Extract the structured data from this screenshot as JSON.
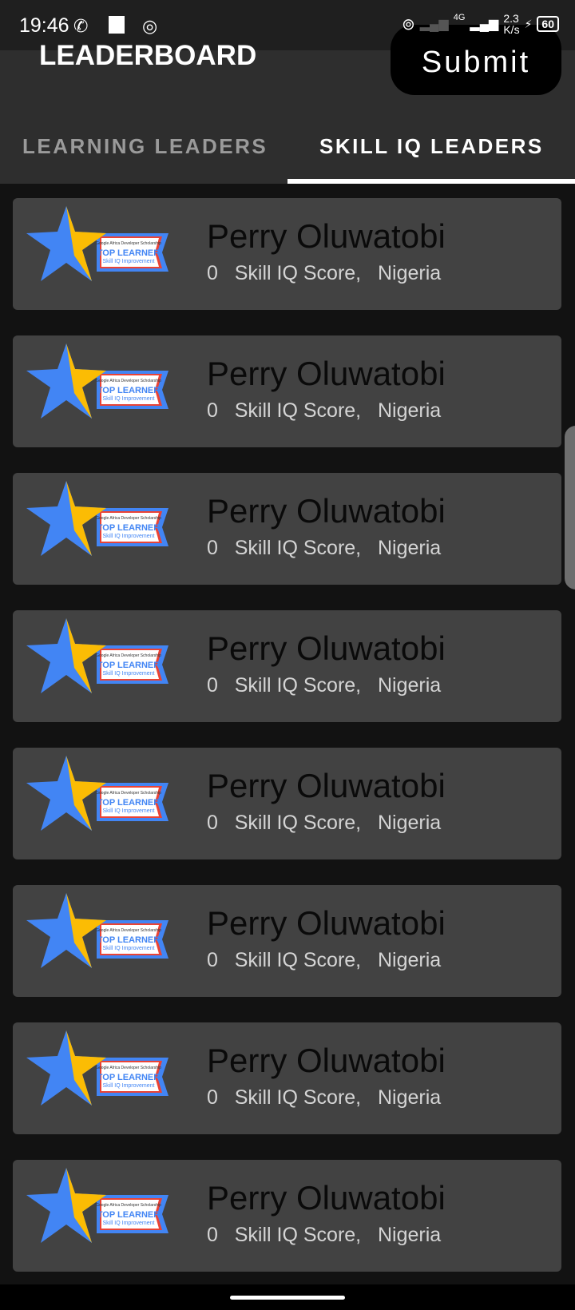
{
  "status_bar": {
    "time": "19:46",
    "network": "4G",
    "speed": "2.3",
    "speed_unit": "K/s",
    "battery": "60"
  },
  "header": {
    "title": "LEADERBOARD",
    "submit_label": "Submit"
  },
  "tabs": [
    {
      "label": "LEARNING LEADERS",
      "active": false
    },
    {
      "label": "SKILL IQ LEADERS",
      "active": true
    }
  ],
  "badge": {
    "org": "Google Africa Developer Scholarship",
    "title": "TOP LEARNER",
    "subtitle": "Skill IQ Improvement"
  },
  "leaders": [
    {
      "name": "Perry Oluwatobi",
      "score": "0",
      "score_label": "Skill IQ Score,",
      "country": "Nigeria"
    },
    {
      "name": "Perry Oluwatobi",
      "score": "0",
      "score_label": "Skill IQ Score,",
      "country": "Nigeria"
    },
    {
      "name": "Perry Oluwatobi",
      "score": "0",
      "score_label": "Skill IQ Score,",
      "country": "Nigeria"
    },
    {
      "name": "Perry Oluwatobi",
      "score": "0",
      "score_label": "Skill IQ Score,",
      "country": "Nigeria"
    },
    {
      "name": "Perry Oluwatobi",
      "score": "0",
      "score_label": "Skill IQ Score,",
      "country": "Nigeria"
    },
    {
      "name": "Perry Oluwatobi",
      "score": "0",
      "score_label": "Skill IQ Score,",
      "country": "Nigeria"
    },
    {
      "name": "Perry Oluwatobi",
      "score": "0",
      "score_label": "Skill IQ Score,",
      "country": "Nigeria"
    },
    {
      "name": "Perry Oluwatobi",
      "score": "0",
      "score_label": "Skill IQ Score,",
      "country": "Nigeria"
    }
  ]
}
